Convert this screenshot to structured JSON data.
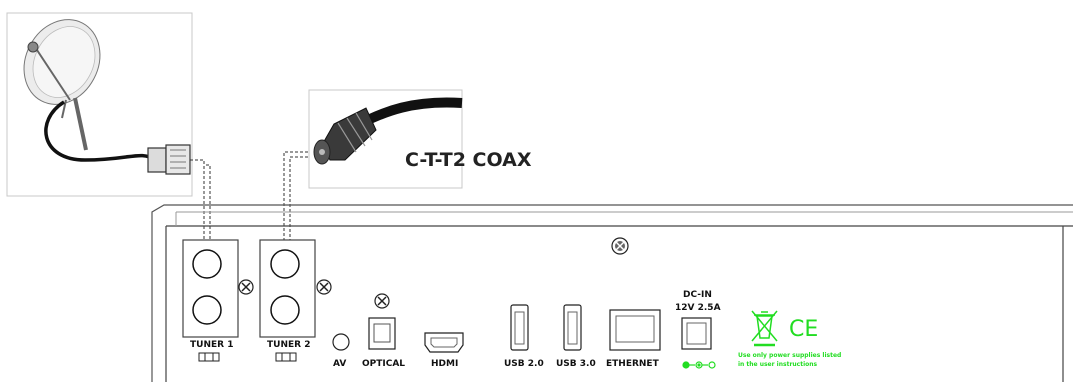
{
  "coax_label": "C-T-T2 COAX",
  "ports": {
    "tuner1": "TUNER 1",
    "tuner2": "TUNER 2",
    "av": "AV",
    "optical": "OPTICAL",
    "hdmi": "HDMI",
    "usb2": "USB 2.0",
    "usb3": "USB 3.0",
    "ethernet": "ETHERNET",
    "dc_in": "DC-IN",
    "dc_rating": "12V  2.5A"
  },
  "warning": {
    "line1": "Use only power supplies listed",
    "line2": "in the user instructions"
  },
  "ce_mark": "CE",
  "colors": {
    "compliance": "#22dd22",
    "outline": "#333333"
  }
}
